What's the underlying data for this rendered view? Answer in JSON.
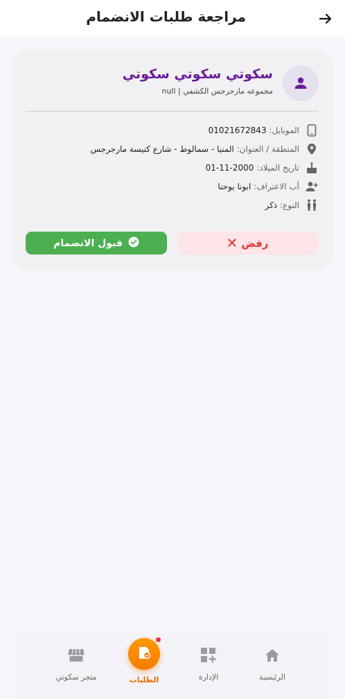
{
  "header": {
    "title": "مراجعة طلبات الانضمام"
  },
  "member": {
    "name": "سكوتي سكوتي سكوتي",
    "group": "مجموعه مارجرجس الكشفي | null",
    "fields": [
      {
        "label": "الموبايل:",
        "value": "01021672843",
        "icon": "phone-icon"
      },
      {
        "label": "المنطقة / العنوان:",
        "value": "المنيا - سمالوط - شارع كنيسة مارجرجس",
        "icon": "location-pin-icon"
      },
      {
        "label": "تاريخ الميلاد:",
        "value": "2000-11-01",
        "icon": "cake-icon"
      },
      {
        "label": "أب الاعتراف:",
        "value": "ابونا يوحنا",
        "icon": "person-add-icon"
      },
      {
        "label": "النوع:",
        "value": "ذكر",
        "icon": "people-icon"
      }
    ],
    "actions": {
      "reject": "رفض",
      "accept": "قبول الانضمام"
    }
  },
  "nav": {
    "items": [
      {
        "label": "الرئيسية",
        "icon": "home-icon"
      },
      {
        "label": "الإدارة",
        "icon": "dashboard-add-icon"
      },
      {
        "label": "الطلبات",
        "icon": "requests-icon",
        "active": true
      },
      {
        "label": "متجر سكوتي",
        "icon": "store-icon"
      }
    ]
  },
  "colors": {
    "accent": "#ef6c00",
    "name": "#6a1b9a",
    "accept": "#4caf50",
    "reject": "#e53935"
  }
}
